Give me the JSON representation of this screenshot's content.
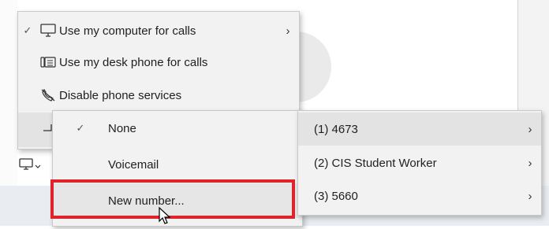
{
  "main_menu": {
    "items": [
      {
        "label": "Use my computer for calls",
        "checked": true,
        "icon": "computer-icon",
        "has_submenu": true
      },
      {
        "label": "Use my desk phone for calls",
        "icon": "desk-phone-icon"
      },
      {
        "label": "Disable phone services",
        "icon": "phone-disabled-icon"
      },
      {
        "label": "",
        "icon": "forward-icon",
        "has_submenu": true
      }
    ]
  },
  "forward_menu": {
    "items": [
      {
        "label": "None",
        "checked": true
      },
      {
        "label": "Voicemail"
      },
      {
        "label": "New number..."
      }
    ]
  },
  "numbers_menu": {
    "items": [
      {
        "label": "(1) 4673"
      },
      {
        "label": "(2) CIS Student Worker"
      },
      {
        "label": "(3) 5660"
      }
    ]
  },
  "glyphs": {
    "check": "✓",
    "chevron": "›"
  },
  "colors": {
    "highlight": "#e0222a",
    "menu_bg": "#f2f2f2"
  }
}
